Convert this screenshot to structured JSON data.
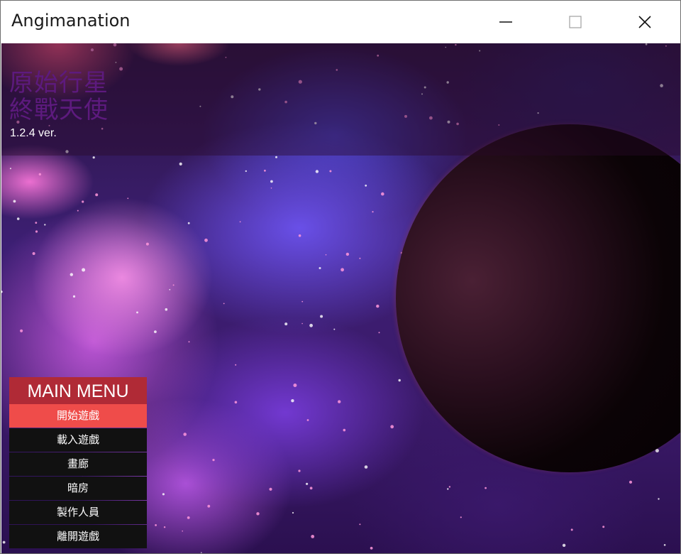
{
  "window": {
    "title": "Angimanation",
    "controls": [
      "minimize-icon",
      "maximize-icon",
      "close-icon"
    ]
  },
  "game": {
    "title_line1": "原始行星",
    "title_line2": "終戰天使",
    "version": "1.2.4 ver."
  },
  "main_menu": {
    "header": "MAIN MENU",
    "items": [
      {
        "label": "開始遊戲",
        "selected": true
      },
      {
        "label": "載入遊戲",
        "selected": false
      },
      {
        "label": "畫廊",
        "selected": false
      },
      {
        "label": "暗房",
        "selected": false
      },
      {
        "label": "製作人員",
        "selected": false
      },
      {
        "label": "離開遊戲",
        "selected": false
      }
    ]
  },
  "colors": {
    "menu_header": "#b02a36",
    "menu_selected": "#ef4c4a",
    "menu_item": "#111111",
    "title_text": "#5d1a7e"
  }
}
